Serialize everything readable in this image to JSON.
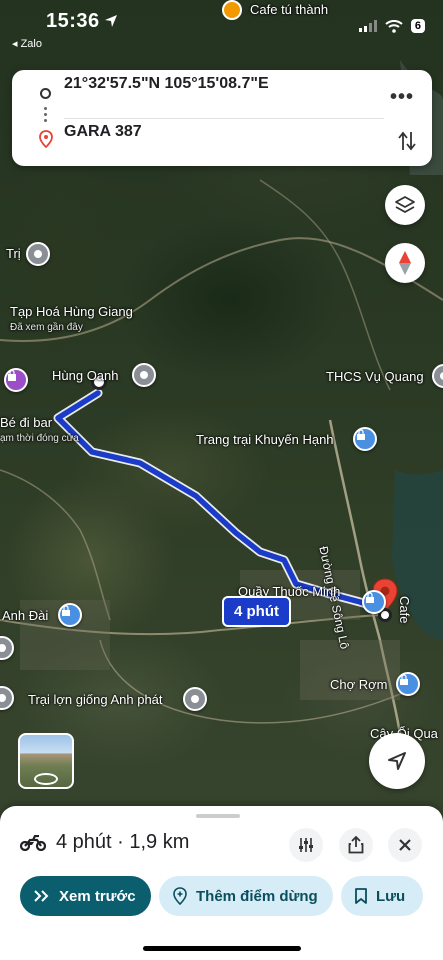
{
  "status_bar": {
    "time": "15:36",
    "back_app": "◂ Zalo",
    "top_label": "Cafe tú thành",
    "battery": "6"
  },
  "route": {
    "origin": "21°32'57.5\"N 105°15'08.7\"E",
    "destination": "GARA 387",
    "more_icon": "more-horizontal-icon",
    "swap_icon": "swap-vertical-icon"
  },
  "map_labels": {
    "tri": "Trị",
    "tap_hoa": "Tạp Hoá Hùng Giang",
    "da_xem": "Đã xem gần đây",
    "hung_oanh": "Hùng Oanh",
    "be_di_bar": "Bé đi bar",
    "tam_thoi": "ạm thời đóng cửa",
    "thcs": "THCS Vụ Quang",
    "trang_trai": "Trang trại Khuyến Hạnh",
    "duong_song_lo": "Đường Đê Sông Lô",
    "quay_thuoc": "Quầy Thuốc Minh",
    "anh_dai": "Anh Đài",
    "trai_lon": "Trại lợn giống Anh phát",
    "cho_rom": "Chợ Rợm",
    "cay_oi": "Cây Ổi Qua",
    "cafe_edge": "Cafe"
  },
  "eta_chip": "4 phút",
  "sheet": {
    "mode_icon": "motorbike-icon",
    "summary": "4 phút · 1,9 km",
    "preview_label": "Xem trước",
    "add_stop_label": "Thêm điểm dừng",
    "save_label": "Lưu"
  },
  "colors": {
    "route": "#1a3cc9",
    "primary_button": "#0b5e6e",
    "secondary_button": "#d6ecf7",
    "pin": "#ea4335"
  }
}
